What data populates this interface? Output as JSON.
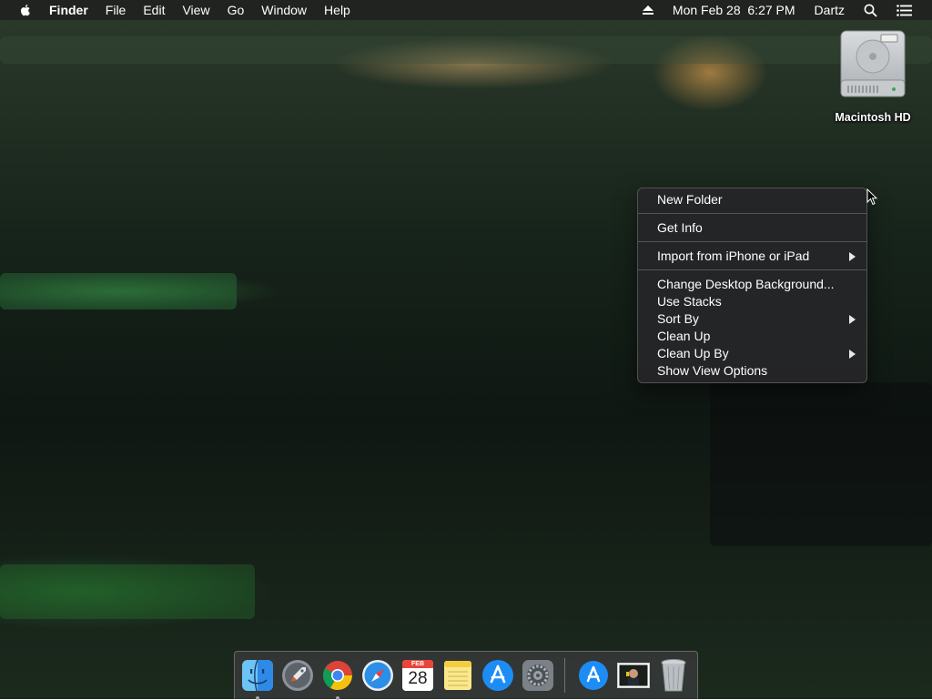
{
  "menubar": {
    "app_name": "Finder",
    "menus": [
      "File",
      "Edit",
      "View",
      "Go",
      "Window",
      "Help"
    ],
    "datetime": "Mon Feb 28  6:27 PM",
    "user": "Dartz",
    "icons": [
      "apple-icon",
      "eject-icon",
      "spotlight-search-icon",
      "notification-center-icon"
    ]
  },
  "desktop": {
    "wallpaper": "photo",
    "drive_label": "Macintosh HD"
  },
  "context_menu": {
    "group1": [
      "New Folder"
    ],
    "group2": [
      "Get Info"
    ],
    "group3": [
      {
        "label": "Import from iPhone or iPad",
        "submenu": true
      }
    ],
    "group4": [
      {
        "label": "Change Desktop Background...",
        "submenu": false
      },
      {
        "label": "Use Stacks",
        "submenu": false
      },
      {
        "label": "Sort By",
        "submenu": true
      },
      {
        "label": "Clean Up",
        "submenu": false
      },
      {
        "label": "Clean Up By",
        "submenu": true
      },
      {
        "label": "Show View Options",
        "submenu": false
      }
    ]
  },
  "dock": {
    "apps": [
      "finder",
      "launchpad",
      "chrome",
      "safari",
      "calendar",
      "notes",
      "app-store",
      "system-preferences"
    ],
    "running": [
      "finder",
      "chrome"
    ],
    "calendar": {
      "month": "FEB",
      "day": "28"
    },
    "right_items": [
      "downloads-stack",
      "document-stack",
      "trash"
    ]
  }
}
